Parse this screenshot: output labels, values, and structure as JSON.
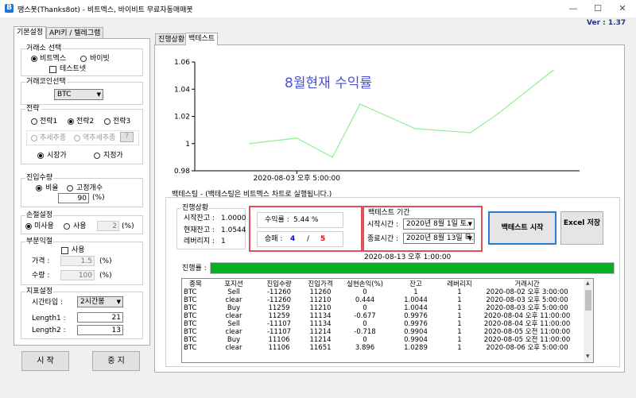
{
  "window": {
    "title": "땡스봇(Thanks8ot) - 비트멕스, 바이비트 무료자동매매봇",
    "minimize": "—",
    "maximize": "☐",
    "close": "✕"
  },
  "version": "Ver :  1.37",
  "left_tabs": [
    "기본설정",
    "API키 / 텔레그램"
  ],
  "exchange": {
    "label": "거래소 선택",
    "options": [
      "비트멕스",
      "바이빗"
    ],
    "selected": "비트멕스",
    "testnet": "테스트넷"
  },
  "coin": {
    "label": "거래코인선택",
    "value": "BTC"
  },
  "strategy": {
    "label": "전략",
    "options": [
      "전략1",
      "전략2",
      "전략3"
    ],
    "selected": "전략2",
    "trend": [
      "추세추종",
      "역추세추종"
    ],
    "help": "?",
    "order_types": [
      "시장가",
      "지정가"
    ],
    "order_selected": "시장가"
  },
  "entry": {
    "label": "진입수량",
    "options": [
      "비율",
      "고정개수"
    ],
    "selected": "비율",
    "value": "90",
    "unit": "(%)"
  },
  "stoploss": {
    "label": "손절설정",
    "options": [
      "미사용",
      "사용"
    ],
    "selected": "미사용",
    "value": "2",
    "unit": "(%)"
  },
  "partial": {
    "label": "부분익절",
    "use": "사용",
    "price_label": "가격 :",
    "price_value": "1.5",
    "qty_label": "수량 :",
    "qty_value": "100",
    "unit": "(%)"
  },
  "indicator": {
    "label": "지표설정",
    "timeframe_label": "시간타입 :",
    "timeframe": "2시간봉",
    "length1_label": "Length1 :",
    "length1": "21",
    "length2_label": "Length2 :",
    "length2": "13"
  },
  "buttons": {
    "start": "시 작",
    "stop": "중 지",
    "backtest_start": "백테스트 시작",
    "excel": "Excel 저장"
  },
  "right_tabs": [
    "진행상황",
    "백테스트"
  ],
  "chart_data": {
    "type": "line",
    "title": "8월현재 수익률",
    "x": [
      "2020-08-02 00:00",
      "2020-08-03 17:00",
      "2020-08-05 00:00",
      "2020-08-06 00:00",
      "2020-08-07 00:00",
      "2020-08-08 00:00",
      "2020-08-10 00:00",
      "2020-08-11 00:00",
      "2020-08-13 00:00"
    ],
    "xticks": [
      "2020-08-03 오후 5:00:00"
    ],
    "series": [
      {
        "values": [
          1.0,
          1.004,
          0.99,
          1.029,
          1.02,
          1.011,
          1.008,
          1.022,
          1.054
        ],
        "color": "#90ee90"
      }
    ],
    "ylim": [
      0.98,
      1.06
    ],
    "yticks": [
      "0.98",
      "1",
      "1.02",
      "1.04",
      "1.06"
    ],
    "title_color": "#4a50d8"
  },
  "backtest": {
    "caption": "백테스팅 - (백테스팅은 비트멕스 차트로 실행됩니다.)",
    "progress_group": "진행상황",
    "start_balance_label": "시작잔고 :",
    "start_balance": "1.0000",
    "current_balance_label": "현재잔고 :",
    "current_balance": "1.0544",
    "leverage_label": "레버리지 :",
    "leverage": "1",
    "return_label": "수익률 :",
    "return_value": "5.44 %",
    "winloss_label": "승패 :",
    "wins": "4",
    "sep": "/",
    "losses": "5",
    "period_group": "백테스트 기간",
    "start_time_label": "시작시간 :",
    "start_time": "2020년  8월  1일 토.",
    "end_time_label": "종료시간 :",
    "end_time": "2020년  8월 13일 목.",
    "progress_time": "2020-08-13 오후 1:00:00",
    "progress_label": "진행률 :",
    "progress_value": 1.0
  },
  "table": {
    "headers": [
      "종목",
      "포지션",
      "진입수량",
      "진입가격",
      "실현손익(%)",
      "잔고",
      "레버리지",
      "거래시간"
    ],
    "rows": [
      [
        "BTC",
        "Sell",
        "-11260",
        "11260",
        "0",
        "1",
        "1",
        "2020-08-02 오후 3:00:00"
      ],
      [
        "BTC",
        "clear",
        "-11260",
        "11210",
        "0.444",
        "1.0044",
        "1",
        "2020-08-03 오후 5:00:00"
      ],
      [
        "BTC",
        "Buy",
        "11259",
        "11210",
        "0",
        "1.0044",
        "1",
        "2020-08-03 오후 5:00:00"
      ],
      [
        "BTC",
        "clear",
        "11259",
        "11134",
        "-0.677",
        "0.9976",
        "1",
        "2020-08-04 오후 11:00:00"
      ],
      [
        "BTC",
        "Sell",
        "-11107",
        "11134",
        "0",
        "0.9976",
        "1",
        "2020-08-04 오후 11:00:00"
      ],
      [
        "BTC",
        "clear",
        "-11107",
        "11214",
        "-0.718",
        "0.9904",
        "1",
        "2020-08-05 오전 11:00:00"
      ],
      [
        "BTC",
        "Buy",
        "11106",
        "11214",
        "0",
        "0.9904",
        "1",
        "2020-08-05 오전 11:00:00"
      ],
      [
        "BTC",
        "clear",
        "11106",
        "11651",
        "3.896",
        "1.0289",
        "1",
        "2020-08-06 오후 5:00:00"
      ]
    ]
  },
  "colors": {
    "accent": "#1e73d6",
    "progress": "#06b025",
    "highlight_box": "#e0505a",
    "wins": "#0000ff",
    "losses": "#ff0000",
    "chart_line": "#90ee90"
  }
}
